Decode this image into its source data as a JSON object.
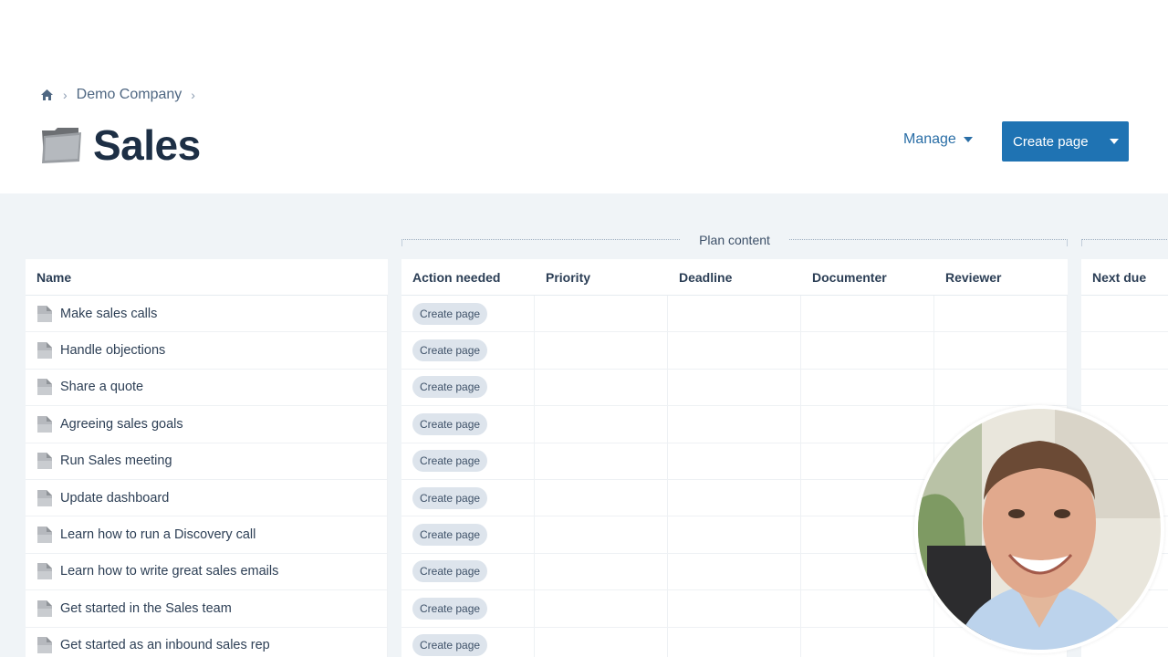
{
  "breadcrumb": {
    "home_icon": "home-icon",
    "items": [
      "Demo Company"
    ]
  },
  "page": {
    "title": "Sales",
    "icon": "folder-icon"
  },
  "actions": {
    "manage_label": "Manage",
    "create_label": "Create page"
  },
  "table": {
    "name_header": "Name",
    "group_label": "Plan content",
    "plan_headers": [
      "Action needed",
      "Priority",
      "Deadline",
      "Documenter",
      "Reviewer"
    ],
    "next_header": "Next due",
    "pill_label": "Create page",
    "rows": [
      "Make sales calls",
      "Handle objections",
      "Share a quote",
      "Agreeing sales goals",
      "Run Sales meeting",
      "Update dashboard",
      "Learn how to run a Discovery call",
      "Learn how to write great sales emails",
      "Get started in the Sales team",
      "Get started as an inbound sales rep"
    ]
  },
  "colors": {
    "primary": "#1f73b3",
    "link": "#2a6ea6",
    "background": "#f0f4f7",
    "title": "#1d2f45"
  }
}
